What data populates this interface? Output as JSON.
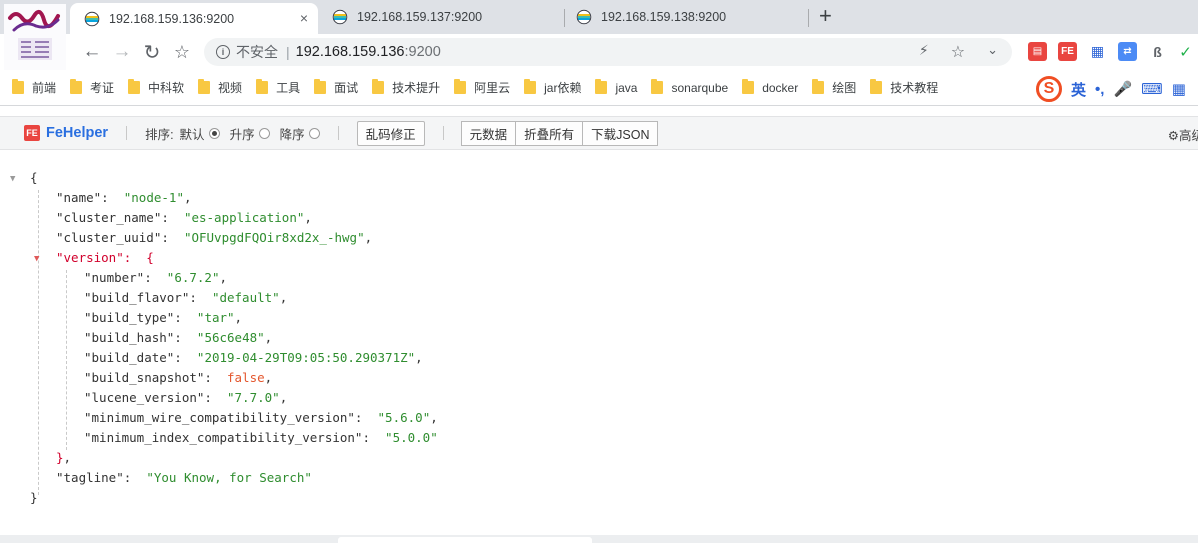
{
  "browser": {
    "tabs": [
      {
        "title": "192.168.159.136:9200",
        "active": true
      },
      {
        "title": "192.168.159.137:9200",
        "active": false
      },
      {
        "title": "192.168.159.138:9200",
        "active": false
      }
    ],
    "new_tab_label": "+",
    "close_label": "×",
    "security_label": "不安全",
    "url_host": "192.168.159.136",
    "url_port": ":9200",
    "accent_color": "#1a73e8"
  },
  "bookmarks": [
    {
      "label": "前端"
    },
    {
      "label": "考证"
    },
    {
      "label": "中科软"
    },
    {
      "label": "视频"
    },
    {
      "label": "工具"
    },
    {
      "label": "面试"
    },
    {
      "label": "技术提升"
    },
    {
      "label": "阿里云"
    },
    {
      "label": "jar依赖"
    },
    {
      "label": "java"
    },
    {
      "label": "sonarqube"
    },
    {
      "label": "docker"
    },
    {
      "label": "绘图"
    },
    {
      "label": "技术教程"
    }
  ],
  "ime": {
    "mode_label": "英",
    "punct_label": "•,"
  },
  "fehelper": {
    "brand": "FeHelper",
    "sort_label": "排序:",
    "sort_default": "默认",
    "sort_asc": "升序",
    "sort_desc": "降序",
    "sort_selected": "默认",
    "fix_encoding": "乱码修正",
    "meta_button": "元数据",
    "collapse_all": "折叠所有",
    "download_json": "下载JSON",
    "advanced": "高级"
  },
  "json": {
    "name": "node-1",
    "cluster_name": "es-application",
    "cluster_uuid": "OFUvpgdFQOir8xd2x_-hwg",
    "version": {
      "number": "6.7.2",
      "build_flavor": "default",
      "build_type": "tar",
      "build_hash": "56c6e48",
      "build_date": "2019-04-29T09:05:50.290371Z",
      "build_snapshot": "false",
      "lucene_version": "7.7.0",
      "minimum_wire_compatibility_version": "5.6.0",
      "minimum_index_compatibility_version": "5.0.0"
    },
    "tagline": "You Know, for Search"
  },
  "colors": {
    "json_string": "#2f8d2f",
    "json_bool": "#e4572e",
    "json_active_key": "#d1002c"
  }
}
